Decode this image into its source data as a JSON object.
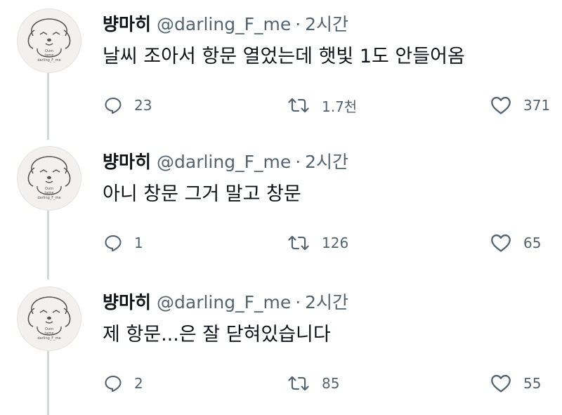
{
  "tweets": [
    {
      "name": "뱡마히",
      "handle": "@darling_F_me",
      "dot": "·",
      "time": "2시간",
      "text": "날씨 조아서 항문 열었는데 햇빛 1도 안들어옴",
      "replies": "23",
      "retweets": "1.7천",
      "likes": "371"
    },
    {
      "name": "뱡마히",
      "handle": "@darling_F_me",
      "dot": "·",
      "time": "2시간",
      "text": "아니 창문 그거 말고 창문",
      "replies": "1",
      "retweets": "126",
      "likes": "65"
    },
    {
      "name": "뱡마히",
      "handle": "@darling_F_me",
      "dot": "·",
      "time": "2시간",
      "text": "제 항문...은 잘 닫혀있습니다",
      "replies": "2",
      "retweets": "85",
      "likes": "55"
    }
  ],
  "avatar": {
    "caption_line1": "Oum",
    "caption_line2": "tame",
    "caption_line3": "darling_F_me"
  },
  "icons": {
    "reply": "reply-icon",
    "retweet": "retweet-icon",
    "like": "heart-icon"
  },
  "colors": {
    "text": "#0f1419",
    "secondary": "#536471",
    "thread_line": "#cfd9de",
    "avatar_bg": "#f3f0ee"
  }
}
